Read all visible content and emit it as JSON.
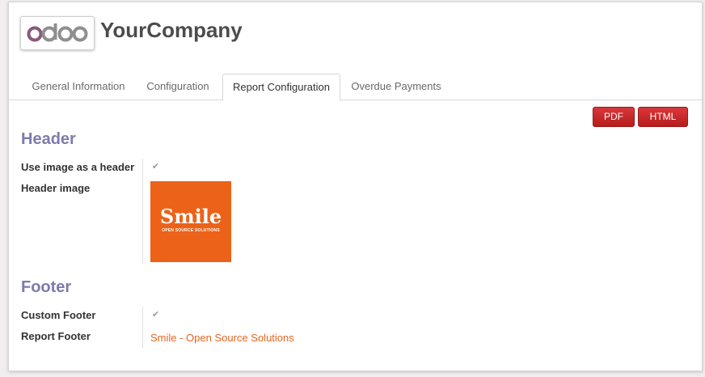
{
  "company": {
    "logo_text": "odoo",
    "name": "YourCompany"
  },
  "tabs": [
    {
      "label": "General Information"
    },
    {
      "label": "Configuration"
    },
    {
      "label": "Report Configuration"
    },
    {
      "label": "Overdue Payments"
    }
  ],
  "active_tab": "Report Configuration",
  "actions": {
    "pdf_label": "PDF",
    "html_label": "HTML"
  },
  "header_section": {
    "title": "Header",
    "use_image_label": "Use image as a header",
    "use_image_checked": true,
    "header_image_label": "Header image",
    "image": {
      "word": "Smile",
      "tagline": "OPEN SOURCE SOLUTIONS"
    }
  },
  "footer_section": {
    "title": "Footer",
    "custom_footer_label": "Custom Footer",
    "custom_footer_checked": true,
    "report_footer_label": "Report Footer",
    "report_footer_value": "Smile - Open Source Solutions"
  },
  "colors": {
    "accent_section": "#7c7bad",
    "button_red": "#c9282a",
    "link_orange": "#e8641e",
    "brand_orange": "#ec6218",
    "odoo_purple": "#875a7b"
  }
}
